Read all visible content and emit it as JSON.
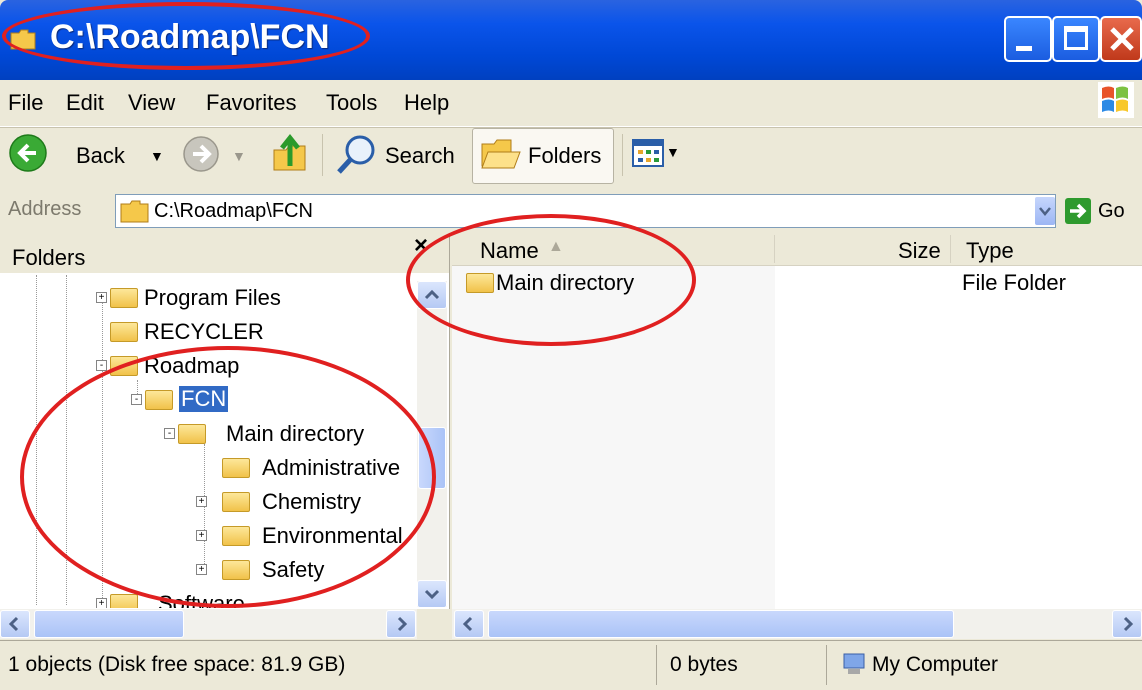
{
  "window": {
    "title": "C:\\Roadmap\\FCN"
  },
  "menu": [
    "File",
    "Edit",
    "View",
    "Favorites",
    "Tools",
    "Help"
  ],
  "toolbar": {
    "back_label": "Back",
    "search_label": "Search",
    "folders_label": "Folders"
  },
  "address": {
    "label": "Address",
    "value": "C:\\Roadmap\\FCN",
    "go_label": "Go"
  },
  "folders_pane": {
    "title": "Folders",
    "close_glyph": "×",
    "items": [
      {
        "label": "Program Files",
        "expander": "+"
      },
      {
        "label": "RECYCLER",
        "expander": ""
      },
      {
        "label": "Roadmap",
        "expander": "-"
      },
      {
        "label": "FCN",
        "expander": "-",
        "selected": true
      },
      {
        "label": "Main directory",
        "expander": "-"
      },
      {
        "label": "Administrative",
        "expander": ""
      },
      {
        "label": "Chemistry",
        "expander": "+"
      },
      {
        "label": "Environmental",
        "expander": "+"
      },
      {
        "label": "Safety",
        "expander": "+"
      },
      {
        "label": "Software",
        "expander": "+"
      }
    ]
  },
  "list": {
    "columns": {
      "name": "Name",
      "size": "Size",
      "type": "Type"
    },
    "rows": [
      {
        "name": "Main directory",
        "size": "",
        "type": "File Folder"
      }
    ]
  },
  "status": {
    "objects": "1 objects (Disk free space: 81.9 GB)",
    "size": "0 bytes",
    "location": "My Computer"
  },
  "colors": {
    "title_blue": "#0a54ea",
    "chrome": "#ece9d8",
    "selection": "#316ac5",
    "annotation": "#e02020"
  }
}
